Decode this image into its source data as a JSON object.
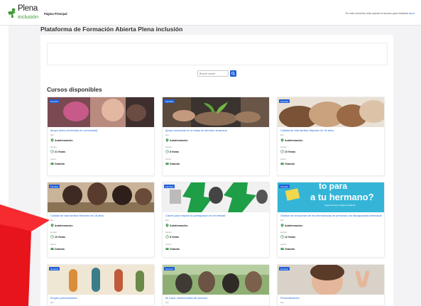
{
  "brand": {
    "name_line1": "Plena",
    "name_line2": "inclusión",
    "colors": {
      "green": "#3e9a32",
      "blue": "#1f5fd6",
      "link": "#1e6bd6",
      "arrow": "#e8141b"
    }
  },
  "nav": {
    "home": "Página Principal"
  },
  "header_info": {
    "text": "En este momento está usando el acceso para invitados",
    "link": "Acce"
  },
  "page": {
    "title": "Plataforma de Formación Abierta Plena inclusión"
  },
  "search": {
    "placeholder": "Buscar cursos",
    "button_icon": "search-icon"
  },
  "courses": {
    "heading": "Cursos disponibles",
    "items": [
      {
        "badge": "General",
        "title": "Apoyo Activo (viviendas en comunidad)",
        "tipo_label": "tipo:",
        "tipo": "Autoformación",
        "tiempo_label": "tiempo:",
        "tiempo": "21 Horas",
        "precio_label": "precio:",
        "precio": "Gratuito"
      },
      {
        "badge": "Familias",
        "title": "Apoyo emocional en la etapa de atención temprana",
        "tipo_label": "tipo:",
        "tipo": "Autoformación",
        "tiempo_label": "tiempo:",
        "tiempo": "8 Horas",
        "precio_label": "precio:",
        "precio": "Gratuito"
      },
      {
        "badge": "Familias",
        "title": "Calidad de vida familiar Mayores de 18 años",
        "tipo_label": "tipo:",
        "tipo": "Autoformación",
        "tiempo_label": "tiempo:",
        "tiempo": "10 Horas",
        "precio_label": "precio:",
        "precio": "Gratuito"
      },
      {
        "badge": "Familias",
        "title": "Calidad de vida familiar Menores de 18 años",
        "tipo_label": "tipo:",
        "tipo": "Autoformación",
        "tiempo_label": "tiempo:",
        "tiempo": "10 Horas",
        "precio_label": "precio:",
        "precio": "Gratuito"
      },
      {
        "badge": "Familias",
        "title": "Claves para mejorar la participación en mi entidad",
        "tipo_label": "tipo:",
        "tipo": "Autoformación",
        "tiempo_label": "tiempo:",
        "tiempo": "8 Horas",
        "precio_label": "precio:",
        "precio": "Gratuito"
      },
      {
        "badge": "Familias",
        "title": "Gestión de emociones de los hermanos/as de personas con discapacidad intelectual",
        "tipo_label": "tipo:",
        "tipo": "Autoformación",
        "tiempo_label": "tiempo:",
        "tiempo": "12 Horas",
        "precio_label": "precio:",
        "precio": "Gratuito"
      },
      {
        "badge": "General",
        "title": "Empleo personalizado",
        "tipo_label": "tipo:"
      },
      {
        "badge": "General",
        "title": "Mi Caso: inmemoriales del proceso",
        "tipo_label": "tipo:"
      },
      {
        "badge": "General",
        "title": "Personalización",
        "tipo_label": "tipo:"
      }
    ]
  },
  "promo_image": {
    "line1": "to para",
    "line2": "a tu hermano?",
    "authors": "Ángela Ponce & Miguel Gallardo"
  }
}
